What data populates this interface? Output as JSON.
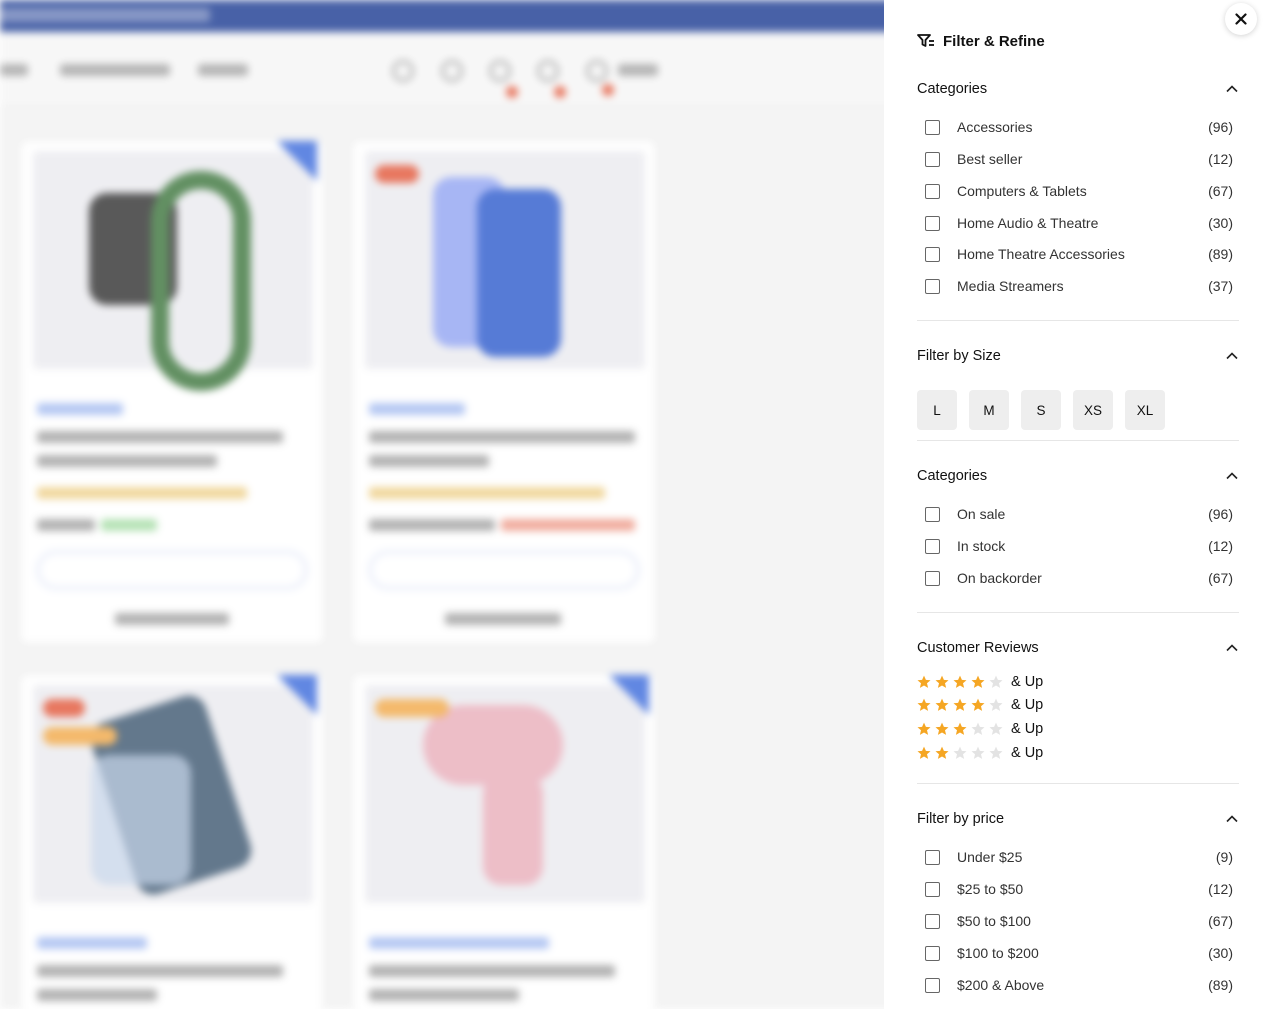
{
  "panel": {
    "title": "Filter & Refine",
    "colors": {
      "star_filled": "#f5a623",
      "star_empty": "#e3e3e3",
      "accent": "#0b2d8a"
    },
    "sections": {
      "categories": {
        "title": "Categories",
        "options": [
          {
            "label": "Accessories",
            "count": "(96)"
          },
          {
            "label": "Best seller",
            "count": "(12)"
          },
          {
            "label": "Computers & Tablets",
            "count": "(67)"
          },
          {
            "label": "Home Audio & Theatre",
            "count": "(30)"
          },
          {
            "label": "Home Theatre Accessories",
            "count": "(89)"
          },
          {
            "label": "Media Streamers",
            "count": "(37)"
          }
        ]
      },
      "size": {
        "title": "Filter by Size",
        "options": [
          "L",
          "M",
          "S",
          "XS",
          "XL"
        ]
      },
      "availability": {
        "title": "Categories",
        "options": [
          {
            "label": "On sale",
            "count": "(96)"
          },
          {
            "label": "In stock",
            "count": "(12)"
          },
          {
            "label": "On backorder",
            "count": "(67)"
          }
        ]
      },
      "reviews": {
        "title": "Customer Reviews",
        "rows": [
          {
            "stars": 4,
            "label": "& Up"
          },
          {
            "stars": 4,
            "label": "& Up"
          },
          {
            "stars": 3,
            "label": "& Up"
          },
          {
            "stars": 2,
            "label": "& Up"
          }
        ]
      },
      "price": {
        "title": "Filter by price",
        "options": [
          {
            "label": "Under $25",
            "count": "(9)"
          },
          {
            "label": "$25 to $50",
            "count": "(12)"
          },
          {
            "label": "$50 to $100",
            "count": "(67)"
          },
          {
            "label": "$100 to $200",
            "count": "(30)"
          },
          {
            "label": "$200 & Above",
            "count": "(89)"
          }
        ]
      }
    }
  }
}
